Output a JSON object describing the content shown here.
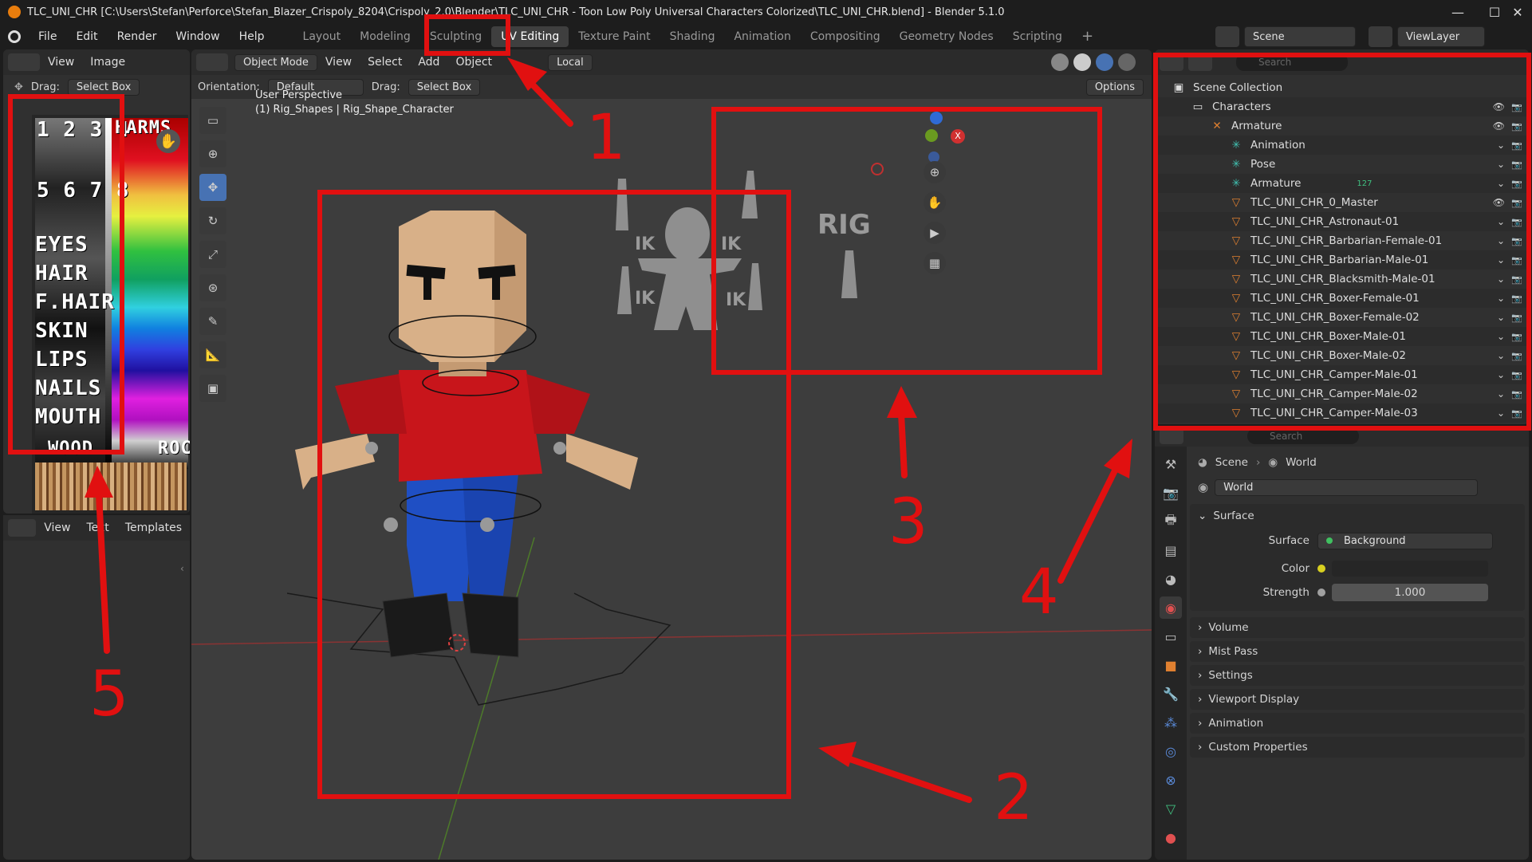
{
  "window": {
    "title": "TLC_UNI_CHR [C:\\Users\\Stefan\\Perforce\\Stefan_Blazer_Crispoly_8204\\Crispoly_2.0\\Blender\\TLC_UNI_CHR - Toon Low Poly Universal Characters Colorized\\TLC_UNI_CHR.blend] - Blender 5.1.0",
    "minimize": "—",
    "maximize": "☐",
    "close": "✕"
  },
  "menus": [
    "File",
    "Edit",
    "Render",
    "Window",
    "Help"
  ],
  "workspaces": [
    "Layout",
    "Modeling",
    "Sculpting",
    "UV Editing",
    "Texture Paint",
    "Shading",
    "Animation",
    "Compositing",
    "Geometry Nodes",
    "Scripting"
  ],
  "active_workspace": "UV Editing",
  "scene_selector": "Scene",
  "viewlayer_selector": "ViewLayer",
  "image_editor": {
    "menus": [
      "View",
      "Image"
    ],
    "drag_label": "Drag:",
    "drag_value": "Select Box",
    "palette_labels": [
      "1 2 3 4",
      "5 6 7 8",
      "EYES",
      "HAIR",
      "F.HAIR",
      "SKIN",
      "LIPS",
      "NAILS",
      "MOUTH"
    ],
    "palette_top_right": "HARMS",
    "palette_bottom": [
      "WOOD",
      "ROC"
    ]
  },
  "text_editor": {
    "menus": [
      "View",
      "Text",
      "Templates"
    ]
  },
  "viewport": {
    "mode": "Object Mode",
    "menus": [
      "View",
      "Select",
      "Add",
      "Object"
    ],
    "transform_space": "Local",
    "orientation_label": "Orientation:",
    "orientation_value": "Default",
    "drag_label": "Drag:",
    "drag_value": "Select Box",
    "options": "Options",
    "overlay_title": "User Perspective",
    "overlay_subtitle": "(1) Rig_Shapes | Rig_Shape_Character",
    "rig_labels": [
      "IK",
      "IK",
      "IK",
      "IK",
      "RIG"
    ]
  },
  "outliner": {
    "search_placeholder": "Search",
    "rows": [
      {
        "label": "Scene Collection",
        "indent": 0
      },
      {
        "label": "Characters",
        "indent": 1
      },
      {
        "label": "Armature",
        "indent": 2
      },
      {
        "label": "Animation",
        "indent": 3
      },
      {
        "label": "Pose",
        "indent": 3
      },
      {
        "label": "Armature",
        "indent": 3,
        "badge": "127"
      },
      {
        "label": "TLC_UNI_CHR_0_Master",
        "indent": 3
      },
      {
        "label": "TLC_UNI_CHR_Astronaut-01",
        "indent": 3
      },
      {
        "label": "TLC_UNI_CHR_Barbarian-Female-01",
        "indent": 3
      },
      {
        "label": "TLC_UNI_CHR_Barbarian-Male-01",
        "indent": 3
      },
      {
        "label": "TLC_UNI_CHR_Blacksmith-Male-01",
        "indent": 3
      },
      {
        "label": "TLC_UNI_CHR_Boxer-Female-01",
        "indent": 3
      },
      {
        "label": "TLC_UNI_CHR_Boxer-Female-02",
        "indent": 3
      },
      {
        "label": "TLC_UNI_CHR_Boxer-Male-01",
        "indent": 3
      },
      {
        "label": "TLC_UNI_CHR_Boxer-Male-02",
        "indent": 3
      },
      {
        "label": "TLC_UNI_CHR_Camper-Male-01",
        "indent": 3
      },
      {
        "label": "TLC_UNI_CHR_Camper-Male-02",
        "indent": 3
      },
      {
        "label": "TLC_UNI_CHR_Camper-Male-03",
        "indent": 3
      }
    ]
  },
  "properties": {
    "search_placeholder": "Search",
    "breadcrumb": [
      "Scene",
      "World"
    ],
    "world_name": "World",
    "surface_panel": "Surface",
    "surface_label": "Surface",
    "surface_value": "Background",
    "color_label": "Color",
    "strength_label": "Strength",
    "strength_value": "1.000",
    "collapsed_panels": [
      "Volume",
      "Mist Pass",
      "Settings",
      "Viewport Display",
      "Animation",
      "Custom Properties"
    ]
  },
  "annotations": [
    "1",
    "2",
    "3",
    "4",
    "5"
  ],
  "colors": {
    "annotation": "#e11010",
    "accent": "#4772b3",
    "shirt": "#c8151b",
    "pants": "#1f4fc4",
    "skin": "#d8b088"
  }
}
